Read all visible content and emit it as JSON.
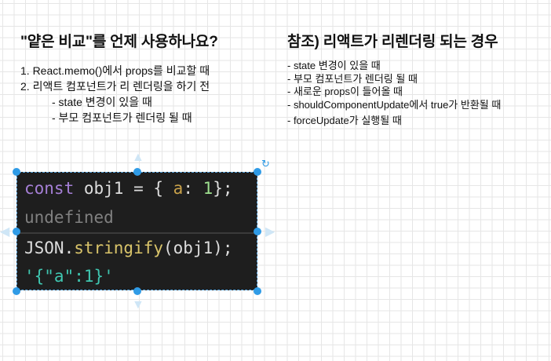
{
  "left": {
    "title": "\"얕은 비교\"를 언제 사용하나요?",
    "items": [
      "1. React.memo()에서 props를 비교할 때",
      "2. 리액트 컴포넌트가 리 렌더링을 하기 전"
    ],
    "subitems": [
      "- state 변경이 있을 때",
      "- 부모 컴포넌트가 렌더링 될 때"
    ]
  },
  "right": {
    "title": "참조) 리액트가 리렌더링 되는 경우",
    "items": [
      "- state 변경이 있을 때",
      "- 부모 컴포넌트가 렌더링 될 때",
      "- 새로운 props이 들어올 때",
      "- shouldComponentUpdate에서 true가 반환될 때"
    ],
    "extra": "- forceUpdate가 실행될 때"
  },
  "code": {
    "l1_kw": "const",
    "l1_a": " obj1 = { ",
    "l1_prop": "a",
    "l1_b": ": ",
    "l1_num": "1",
    "l1_c": "};",
    "l2": "undefined",
    "l3_a": "JSON.",
    "l3_fn": "stringify",
    "l3_b": "(obj1);",
    "l4": "'{\"a\":1}'"
  },
  "colors": {
    "selection": "#2f9be6",
    "code_bg": "#1e1e1e"
  }
}
